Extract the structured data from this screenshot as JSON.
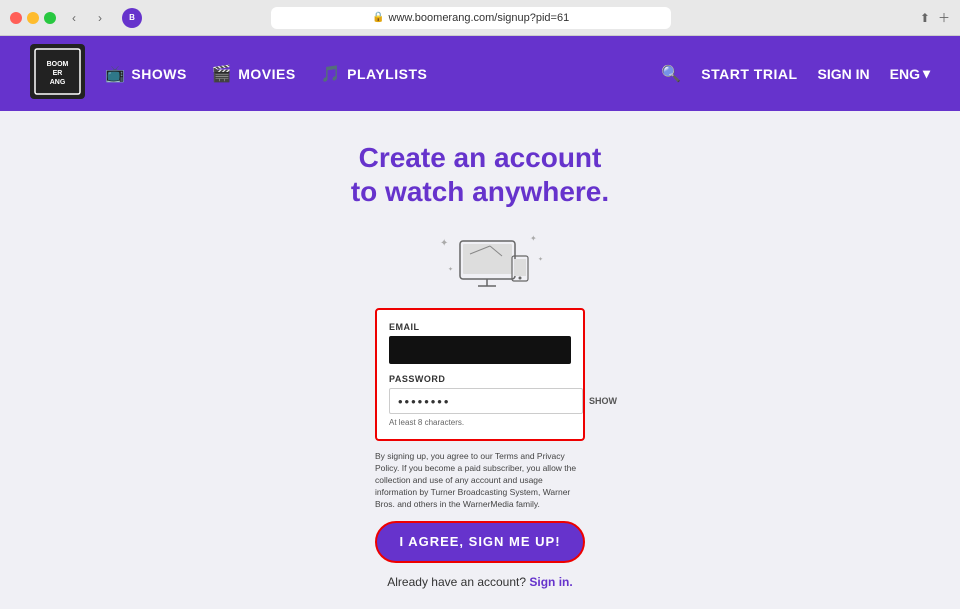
{
  "browser": {
    "url": "www.boomerang.com/signup?pid=61",
    "back_label": "‹",
    "forward_label": "›"
  },
  "navbar": {
    "brand": "BOOMERANG",
    "shows_label": "SHOWS",
    "movies_label": "MOVIES",
    "playlists_label": "PLAYLISTS",
    "start_trial_label": "START TRIAL",
    "sign_in_label": "SIGN IN",
    "lang_label": "ENG",
    "lang_chevron": "▾"
  },
  "page": {
    "title_line1": "Create an account",
    "title_line2": "to watch anywhere.",
    "email_label": "EMAIL",
    "email_value": "",
    "password_label": "PASSWORD",
    "password_value": "••••••••",
    "show_label": "SHOW",
    "hint_text": "At least 8 characters.",
    "legal_text": "By signing up, you agree to our Terms and Privacy Policy. If you become a paid subscriber, you allow the collection and use of any account and usage information by Turner Broadcasting System, Warner Bros. and others in the WarnerMedia family.",
    "signup_btn_label": "I AGREE, SIGN ME UP!",
    "already_text": "Already have an account?",
    "signin_link": "Sign in."
  }
}
